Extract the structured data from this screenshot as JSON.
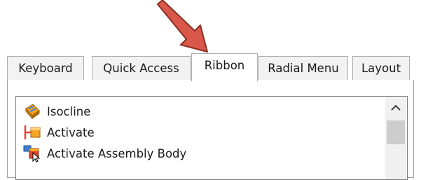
{
  "tabs": [
    {
      "label": "Keyboard"
    },
    {
      "label": "Quick Access"
    },
    {
      "label": "Ribbon"
    },
    {
      "label": "Radial Menu"
    },
    {
      "label": "Layout"
    }
  ],
  "active_tab": "Ribbon",
  "list": {
    "items": [
      {
        "label": "Isocline",
        "icon": "isocline-icon"
      },
      {
        "label": "Activate",
        "icon": "activate-icon"
      },
      {
        "label": "Activate Assembly Body",
        "icon": "activate-assembly-body-icon"
      }
    ]
  },
  "colors": {
    "arrow": "#d9584a",
    "arrow_outline": "#8b2f24",
    "accent_orange": "#f5a623",
    "accent_red": "#e0452e",
    "accent_blue": "#3d7fd1"
  }
}
